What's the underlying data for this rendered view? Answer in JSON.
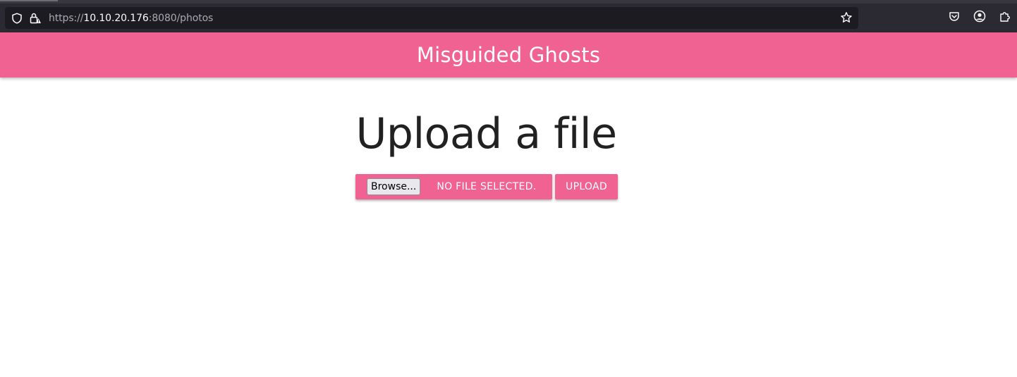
{
  "browser": {
    "url_scheme": "https://",
    "url_host": "10.10.20.176",
    "url_rest": ":8080/photos",
    "icons": {
      "shield": "shield-icon",
      "lock": "lock-warning-icon",
      "star": "bookmark-star-icon",
      "pocket": "pocket-icon",
      "account": "account-icon",
      "extensions": "extensions-icon"
    }
  },
  "header": {
    "title": "Misguided Ghosts",
    "color": "#f06292"
  },
  "main": {
    "heading": "Upload a file",
    "browse_label": "Browse...",
    "file_status": "NO FILE SELECTED.",
    "upload_label": "UPLOAD"
  }
}
